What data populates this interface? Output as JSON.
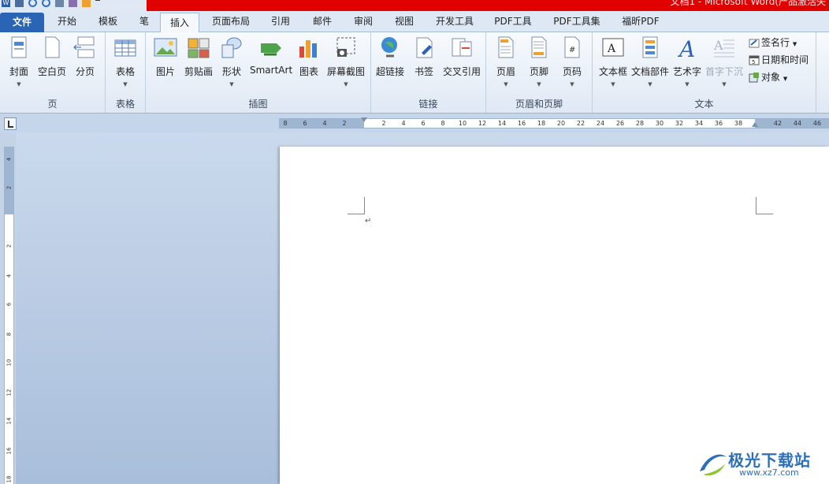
{
  "window": {
    "title": "文档1 - Microsoft Word(产品激活失"
  },
  "tabs": {
    "file": "文件",
    "items": [
      "开始",
      "模板",
      "笔",
      "插入",
      "页面布局",
      "引用",
      "邮件",
      "审阅",
      "视图",
      "开发工具",
      "PDF工具",
      "PDF工具集",
      "福昕PDF"
    ],
    "active": "插入"
  },
  "ribbon": {
    "groups": {
      "page": {
        "label": "页",
        "buttons": [
          "封面",
          "空白页",
          "分页"
        ]
      },
      "table": {
        "label": "表格",
        "buttons": [
          "表格"
        ]
      },
      "illustrations": {
        "label": "插图",
        "buttons": [
          "图片",
          "剪贴画",
          "形状",
          "SmartArt",
          "图表",
          "屏幕截图"
        ]
      },
      "links": {
        "label": "链接",
        "buttons": [
          "超链接",
          "书签",
          "交叉引用"
        ]
      },
      "header_footer": {
        "label": "页眉和页脚",
        "buttons": [
          "页眉",
          "页脚",
          "页码"
        ]
      },
      "text": {
        "label": "文本",
        "buttons": [
          "文本框",
          "文档部件",
          "艺术字",
          "首字下沉"
        ],
        "small": [
          "签名行",
          "日期和时间",
          "对象"
        ]
      }
    }
  },
  "ruler": {
    "horizontal_ticks": [
      "8",
      "6",
      "4",
      "2",
      "2",
      "4",
      "6",
      "8",
      "10",
      "12",
      "14",
      "16",
      "18",
      "20",
      "22",
      "24",
      "26",
      "28",
      "30",
      "32",
      "34",
      "36",
      "38",
      "42",
      "44",
      "46"
    ],
    "vertical_ticks": [
      "4",
      "2",
      "2",
      "4",
      "6",
      "8",
      "10",
      "12",
      "14",
      "16",
      "18"
    ]
  },
  "document": {
    "paragraph_mark": "↵"
  },
  "watermark": {
    "name": "极光下载站",
    "url": "www.xz7.com"
  },
  "colors": {
    "accent": "#2a64b5",
    "title_red": "#e00000",
    "ribbon_bg": "#dfe8f4"
  }
}
